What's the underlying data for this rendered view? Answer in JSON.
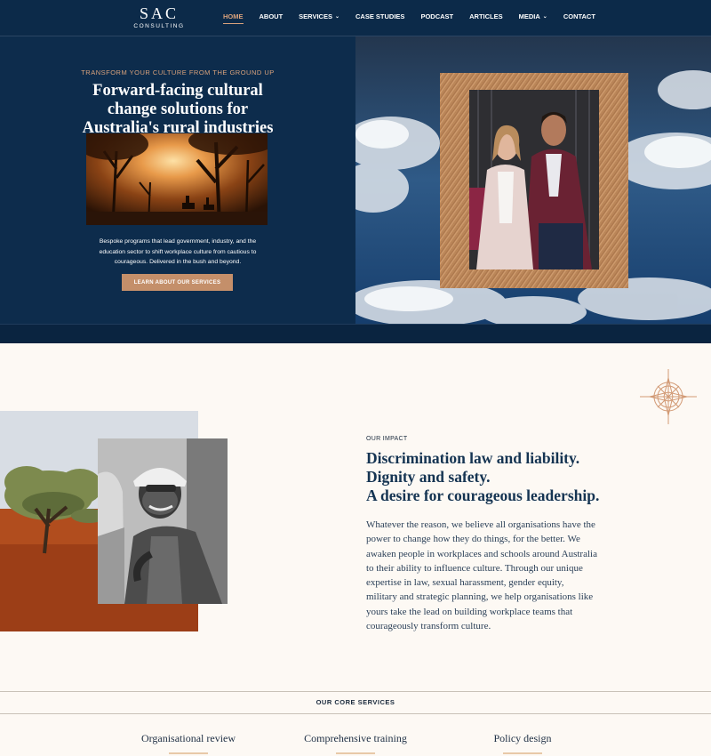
{
  "nav": {
    "logo_main": "SAC",
    "logo_sub": "CONSULTING",
    "items": [
      {
        "label": "HOME",
        "active": true,
        "dropdown": false
      },
      {
        "label": "ABOUT",
        "active": false,
        "dropdown": false
      },
      {
        "label": "SERVICES",
        "active": false,
        "dropdown": true
      },
      {
        "label": "CASE STUDIES",
        "active": false,
        "dropdown": false
      },
      {
        "label": "PODCAST",
        "active": false,
        "dropdown": false
      },
      {
        "label": "ARTICLES",
        "active": false,
        "dropdown": false
      },
      {
        "label": "MEDIA",
        "active": false,
        "dropdown": true
      },
      {
        "label": "CONTACT",
        "active": false,
        "dropdown": false
      }
    ]
  },
  "hero": {
    "eyebrow": "TRANSFORM YOUR CULTURE FROM THE GROUND UP",
    "title": "Forward-facing cultural change solutions for Australia's rural industries and organisations.",
    "description": "Bespoke programs that lead government, industry, and the education sector to shift workplace culture from cautious to courageous. Delivered in the bush and beyond.",
    "cta_label": "LEARN ABOUT OUR SERVICES"
  },
  "impact": {
    "eyebrow": "OUR IMPACT",
    "title_lines": [
      "Discrimination law and liability.",
      "Dignity and safety.",
      "A desire for courageous leadership."
    ],
    "body": "Whatever the reason, we believe all organisations have the power to change how they do things, for the better. We awaken people in workplaces and schools around Australia to their ability to influence culture. Through our unique expertise in law, sexual harassment, gender equity, military and strategic planning, we help organisations like yours take the lead on building workplace teams that courageously transform culture."
  },
  "services": {
    "heading": "OUR CORE SERVICES",
    "items": [
      {
        "label": "Organisational review"
      },
      {
        "label": "Comprehensive training"
      },
      {
        "label": "Policy design"
      }
    ]
  },
  "colors": {
    "navy": "#0c2a49",
    "accent": "#d9a27c",
    "button": "#c48f6a",
    "cream": "#fdf9f4"
  }
}
